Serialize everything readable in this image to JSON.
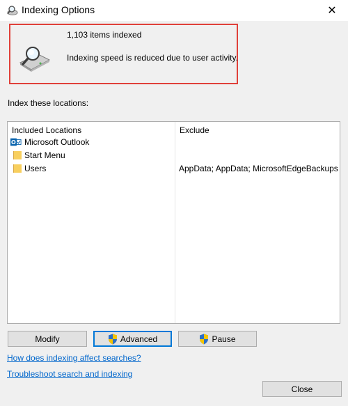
{
  "window": {
    "title": "Indexing Options",
    "close_glyph": "✕"
  },
  "status": {
    "items_indexed": "1,103 items indexed",
    "message": "Indexing speed is reduced due to user activity.",
    "highlight_color": "#e0403a"
  },
  "locations": {
    "section_label": "Index these locations:",
    "col_included": "Included Locations",
    "col_exclude": "Exclude",
    "rows": [
      {
        "name": "Microsoft Outlook",
        "icon": "outlook-icon",
        "exclude": ""
      },
      {
        "name": "Start Menu",
        "icon": "folder-icon",
        "exclude": ""
      },
      {
        "name": "Users",
        "icon": "folder-icon",
        "exclude": "AppData; AppData; MicrosoftEdgeBackups"
      }
    ]
  },
  "buttons": {
    "modify": "Modify",
    "advanced": "Advanced",
    "pause": "Pause",
    "close": "Close"
  },
  "links": {
    "how_affect": "How does indexing affect searches?",
    "troubleshoot": "Troubleshoot search and indexing"
  },
  "colors": {
    "link": "#0066cc",
    "accent": "#0078d7"
  }
}
